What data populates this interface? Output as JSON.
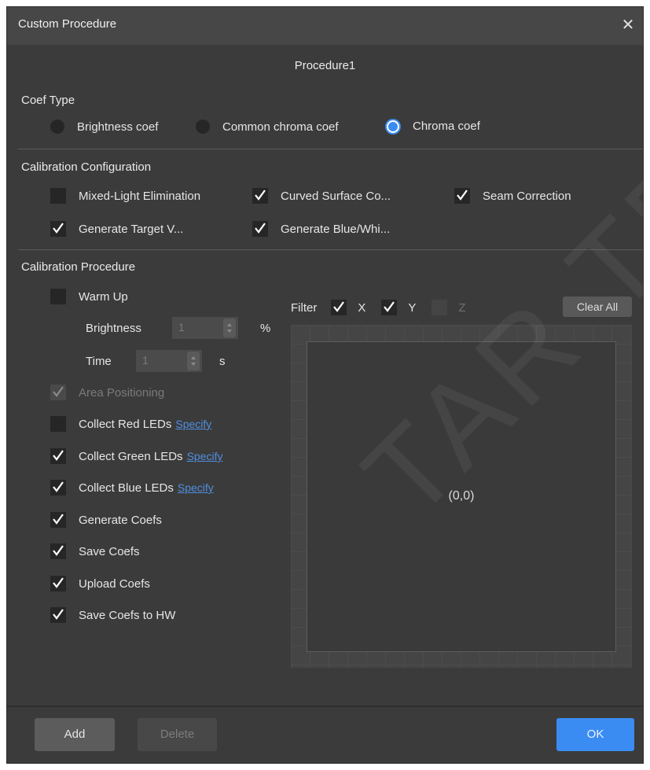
{
  "window": {
    "title": "Custom Procedure",
    "close_icon": "close-icon"
  },
  "procedure_name": "Procedure1",
  "coef_type": {
    "title": "Coef Type",
    "options": [
      {
        "label": "Brightness coef",
        "selected": false
      },
      {
        "label": "Common chroma coef",
        "selected": false
      },
      {
        "label": "Chroma coef",
        "selected": true
      }
    ]
  },
  "calibration_configuration": {
    "title": "Calibration Configuration",
    "items": [
      {
        "label": "Mixed-Light Elimination",
        "checked": false
      },
      {
        "label": "Curved Surface Co...",
        "checked": true
      },
      {
        "label": "Seam Correction",
        "checked": true
      },
      {
        "label": "Generate Target V...",
        "checked": true
      },
      {
        "label": "Generate Blue/Whi...",
        "checked": true
      }
    ]
  },
  "calibration_procedure": {
    "title": "Calibration Procedure",
    "warm_up": {
      "label": "Warm Up",
      "checked": false
    },
    "brightness": {
      "label": "Brightness",
      "value": "1",
      "unit": "%"
    },
    "time": {
      "label": "Time",
      "value": "1",
      "unit": "s"
    },
    "steps": [
      {
        "label": "Area Positioning",
        "checked": true,
        "disabled": true,
        "link": ""
      },
      {
        "label": "Collect Red LEDs",
        "checked": false,
        "disabled": false,
        "link": "Specify"
      },
      {
        "label": "Collect Green LEDs",
        "checked": true,
        "disabled": false,
        "link": "Specify"
      },
      {
        "label": "Collect Blue LEDs",
        "checked": true,
        "disabled": false,
        "link": "Specify"
      },
      {
        "label": "Generate Coefs",
        "checked": true,
        "disabled": false,
        "link": ""
      },
      {
        "label": "Save Coefs",
        "checked": true,
        "disabled": false,
        "link": ""
      },
      {
        "label": "Upload Coefs",
        "checked": true,
        "disabled": false,
        "link": ""
      },
      {
        "label": "Save Coefs to HW",
        "checked": true,
        "disabled": false,
        "link": ""
      }
    ]
  },
  "filter": {
    "label": "Filter",
    "x": {
      "label": "X",
      "checked": true
    },
    "y": {
      "label": "Y",
      "checked": true
    },
    "z": {
      "label": "Z",
      "checked": false,
      "disabled": true
    },
    "clear_all": "Clear All"
  },
  "preview": {
    "origin_label": "(0,0)"
  },
  "footer": {
    "add": "Add",
    "delete": "Delete",
    "ok": "OK"
  },
  "watermark": "TAR TECH C",
  "colors": {
    "accent": "#3b8cf2",
    "background": "#3b3b3b",
    "link": "#4f8fe0"
  }
}
